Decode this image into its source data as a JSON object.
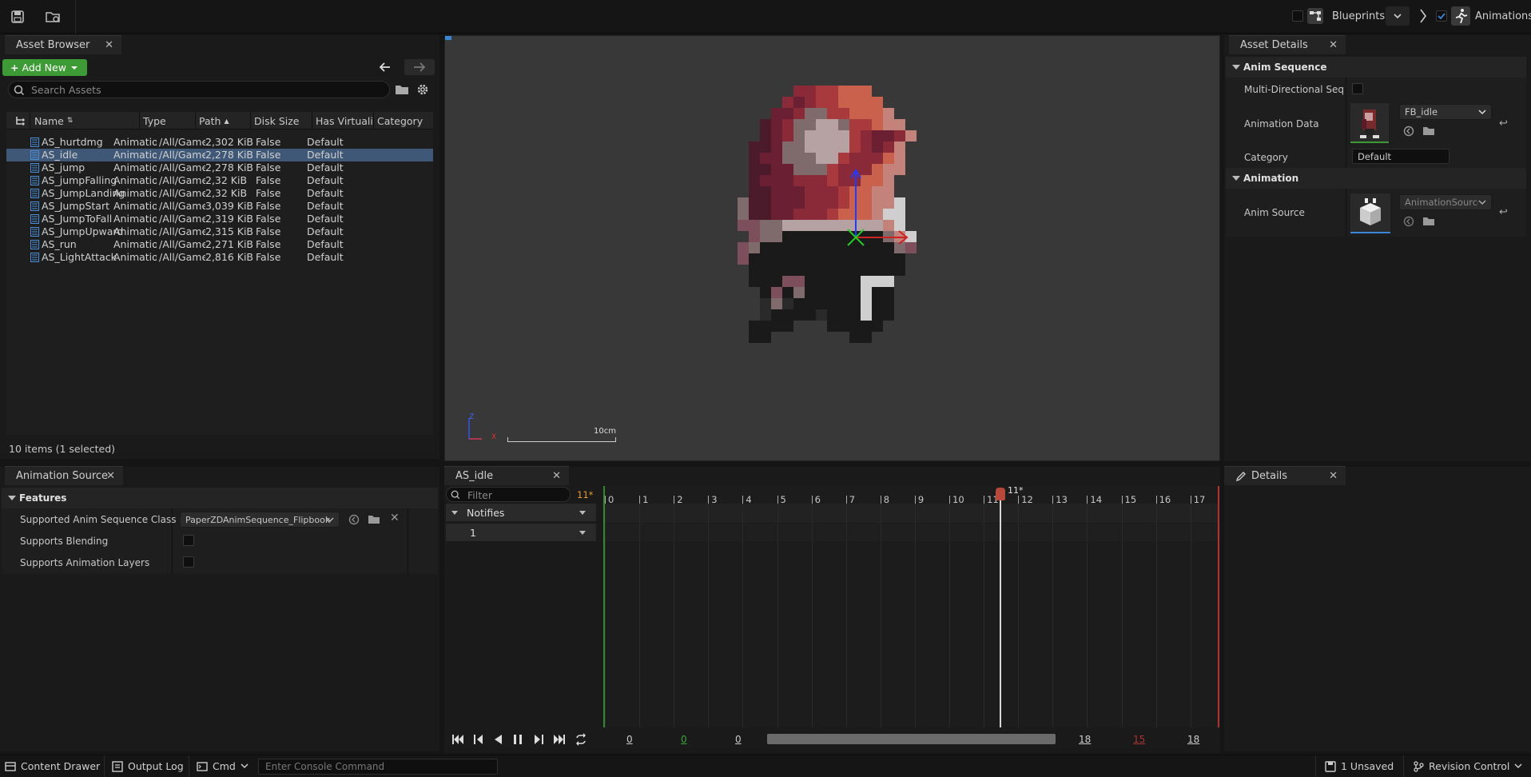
{
  "toolbar": {
    "blueprints_label": "Blueprints",
    "animations_label": "Animations"
  },
  "asset_browser": {
    "tab": "Asset Browser",
    "add_new": "Add New",
    "search_placeholder": "Search Assets",
    "columns": [
      "Name",
      "Type",
      "Path",
      "Disk Size",
      "Has Virtualiz",
      "Category"
    ],
    "rows": [
      {
        "name": "AS_hurtdmg",
        "type": "Animation:",
        "path": "/All/Game,",
        "size": "2,302 KiB",
        "virt": "False",
        "cat": "Default"
      },
      {
        "name": "AS_idle",
        "type": "Animation:",
        "path": "/All/Game,",
        "size": "2,278 KiB",
        "virt": "False",
        "cat": "Default"
      },
      {
        "name": "AS_jump",
        "type": "Animation:",
        "path": "/All/Game,",
        "size": "2,278 KiB",
        "virt": "False",
        "cat": "Default"
      },
      {
        "name": "AS_jumpFalling",
        "type": "Animation:",
        "path": "/All/Game,",
        "size": "2,32 KiB",
        "virt": "False",
        "cat": "Default"
      },
      {
        "name": "AS_JumpLanding",
        "type": "Animation:",
        "path": "/All/Game,",
        "size": "2,32 KiB",
        "virt": "False",
        "cat": "Default"
      },
      {
        "name": "AS_JumpStart",
        "type": "Animation:",
        "path": "/All/Game,",
        "size": "3,039 KiB",
        "virt": "False",
        "cat": "Default"
      },
      {
        "name": "AS_JumpToFall",
        "type": "Animation:",
        "path": "/All/Game,",
        "size": "2,319 KiB",
        "virt": "False",
        "cat": "Default"
      },
      {
        "name": "AS_JumpUpward",
        "type": "Animation:",
        "path": "/All/Game,",
        "size": "2,315 KiB",
        "virt": "False",
        "cat": "Default"
      },
      {
        "name": "AS_run",
        "type": "Animation:",
        "path": "/All/Game,",
        "size": "2,271 KiB",
        "virt": "False",
        "cat": "Default"
      },
      {
        "name": "AS_LightAttack",
        "type": "Animation:",
        "path": "/All/Game,",
        "size": "2,816 KiB",
        "virt": "False",
        "cat": "Default"
      }
    ],
    "status": "10 items (1 selected)"
  },
  "viewport": {
    "scale_label": "10cm",
    "axis_z": "Z",
    "axis_x": "X"
  },
  "asset_details": {
    "tab": "Asset Details",
    "section_anim_sequence": "Anim Sequence",
    "multi_directional": "Multi-Directional Sequ...",
    "animation_data": "Animation Data",
    "animation_data_value": "FB_idle",
    "category": "Category",
    "category_value": "Default",
    "section_animation": "Animation",
    "anim_source": "Anim Source",
    "anim_source_value": "AnimationSource"
  },
  "animation_source": {
    "tab": "Animation Source",
    "section_features": "Features",
    "supported_class_label": "Supported Anim Sequence Class",
    "supported_class_value": "PaperZDAnimSequence_Flipbook",
    "supports_blending": "Supports Blending",
    "supports_layers": "Supports Animation Layers"
  },
  "timeline": {
    "tab": "AS_idle",
    "filter_placeholder": "Filter",
    "frame_marker": "11*",
    "notifies": "Notifies",
    "track_1": "1",
    "playhead_label": "11*",
    "ticks": [
      "0",
      "1",
      "2",
      "3",
      "4",
      "5",
      "6",
      "7",
      "8",
      "9",
      "10",
      "11",
      "12",
      "13",
      "14",
      "15",
      "16",
      "17"
    ],
    "range_start": "0",
    "range_start_green": "0",
    "range_view_start": "0",
    "range_view_end": "18",
    "range_end_red": "15",
    "range_end": "18"
  },
  "details": {
    "tab": "Details"
  },
  "status_bar": {
    "content_drawer": "Content Drawer",
    "output_log": "Output Log",
    "cmd": "Cmd",
    "console_placeholder": "Enter Console Command",
    "unsaved": "1 Unsaved",
    "revision_control": "Revision Control"
  },
  "colors": {
    "accent_green": "#3d9b35",
    "selection_blue": "#3f5877",
    "playhead_red": "#b8473c"
  }
}
